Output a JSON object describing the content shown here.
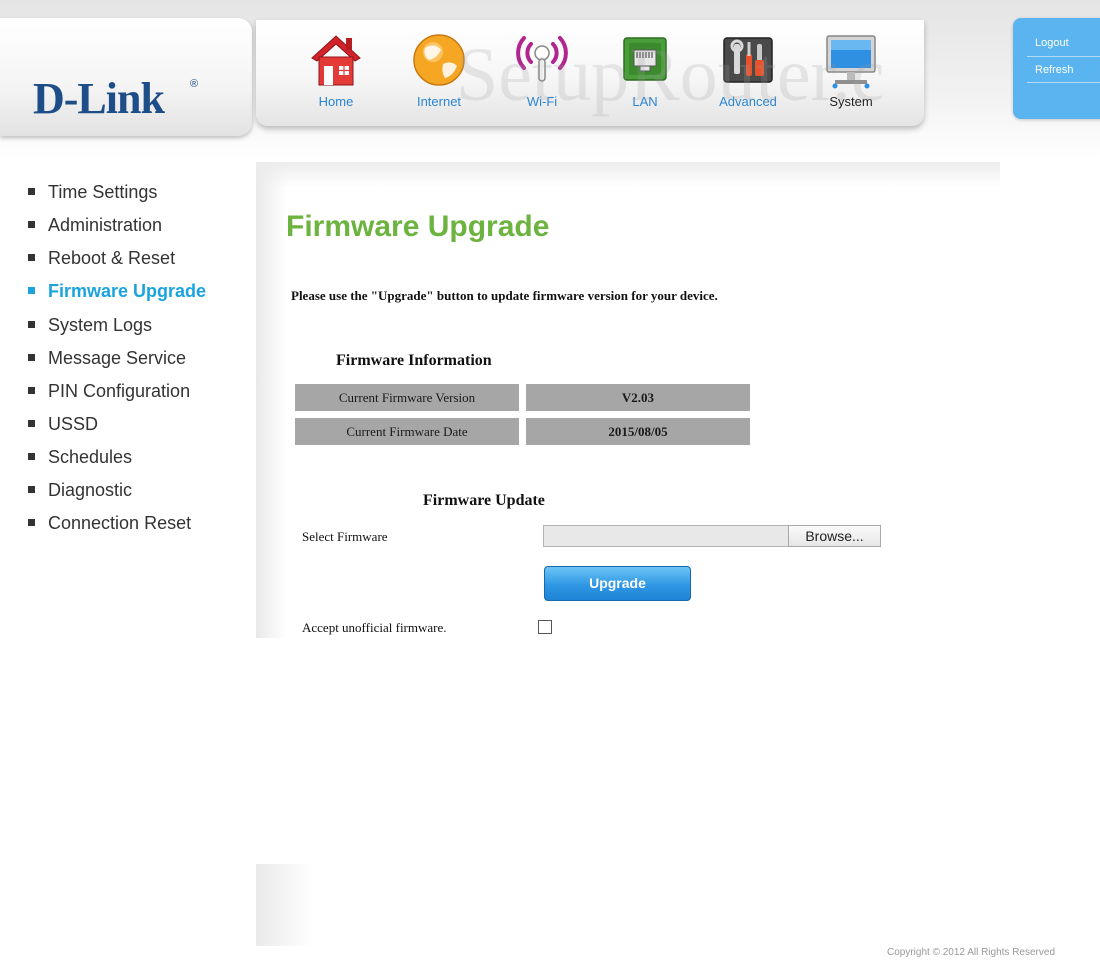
{
  "brand": {
    "logo_text": "D-Link",
    "reg_mark": "®"
  },
  "watermark": "SetupRouter.c",
  "nav": [
    {
      "label": "Home",
      "icon": "home-icon"
    },
    {
      "label": "Internet",
      "icon": "globe-icon"
    },
    {
      "label": "Wi-Fi",
      "icon": "wifi-icon"
    },
    {
      "label": "LAN",
      "icon": "lan-port-icon"
    },
    {
      "label": "Advanced",
      "icon": "tools-icon"
    },
    {
      "label": "System",
      "icon": "monitor-icon",
      "active": true
    }
  ],
  "side_tab": {
    "logout": "Logout",
    "refresh": "Refresh"
  },
  "sidebar": {
    "items": [
      {
        "label": "Time Settings"
      },
      {
        "label": "Administration"
      },
      {
        "label": "Reboot & Reset"
      },
      {
        "label": "Firmware Upgrade",
        "active": true
      },
      {
        "label": "System Logs"
      },
      {
        "label": "Message Service"
      },
      {
        "label": "PIN Configuration"
      },
      {
        "label": "USSD"
      },
      {
        "label": "Schedules"
      },
      {
        "label": "Diagnostic"
      },
      {
        "label": "Connection Reset"
      }
    ]
  },
  "main": {
    "title": "Firmware Upgrade",
    "intro": "Please use the \"Upgrade\" button to update firmware version for your device.",
    "info_title": "Firmware Information",
    "info_rows": [
      {
        "label": "Current Firmware Version",
        "value": "V2.03"
      },
      {
        "label": "Current Firmware Date",
        "value": "2015/08/05"
      }
    ],
    "update_title": "Firmware Update",
    "select_label": "Select Firmware",
    "file_value": "",
    "browse_label": "Browse...",
    "upgrade_label": "Upgrade",
    "accept_label": "Accept unofficial firmware.",
    "accept_checked": false
  },
  "footer": {
    "copyright": "Copyright © 2012  All Rights Reserved"
  },
  "colors": {
    "brand_blue": "#1d4e87",
    "nav_label": "#2b86d4",
    "active_sidebar": "#1ba3df",
    "title_green": "#6db33f",
    "info_cell": "#a6a6a6",
    "side_tab": "#5ab4f0"
  }
}
